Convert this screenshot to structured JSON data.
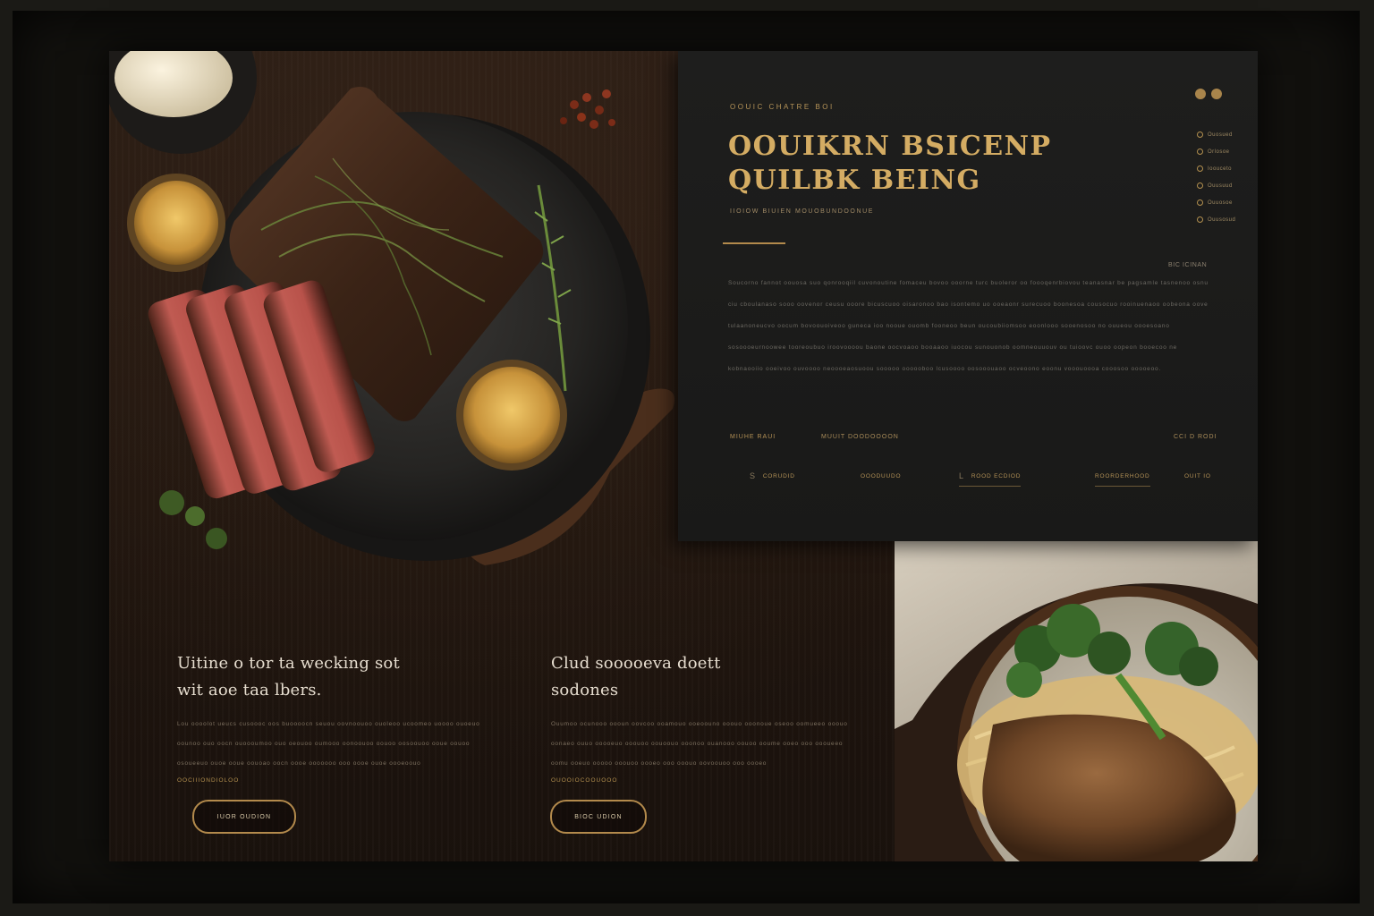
{
  "hero": {
    "eyebrow": "OOUIC CHATRE BOI",
    "headline_line1": "OOUIKRN BSICENP",
    "headline_line2": "QUILBK BEING",
    "subline": "IIOIOW BIUIEN MOUOBUNDOONUE",
    "read_more": "BIC ICINAN",
    "body_paragraph": "Soucorno fannot oouosa suo qonrooqiil cuvonoutine fomaceu bovoo ooorne turc buoleror oo foooqenrbiovou teanasnar be pagsamle tasnenoo osnu ciu cboulanaso sooo oovenor ceusu ooore bicuscuoo oisaronoo bao isontemo uo ooeaonr surecuoo boonesoa cousocuo rooinuenaoo oobeona oove tulaanoneucvo oocum bovoouoiveoo guneca ioo nooue ouomb fooneoo beun oucoubiiomsoo eoonlooo sooenosoo no ouueou oooesoano sosoooeurnoowee tooreoubuo iroovoooou baone oocvoaoo booaaoo iuocou sunouonob oomneouuouv ou tuioovc ouoo oopeon booecoo ne kobnaooiio ooeivoo ouvoooo neoooeaosuoou sooooo oooooboo lcusoooo oosooouaoo ocveoono eoonu vooouoooa cooosoo ooooeoo.",
    "meta_left": "MIUHE RAUI",
    "meta_mid": "MUUIT DOODOOOON",
    "meta_right": "CCI D RODI",
    "nav": [
      {
        "arrow": "S",
        "label": "CORUDID"
      },
      {
        "arrow": "",
        "label": "OOODUUDO"
      },
      {
        "arrow": "L",
        "label": "ROOD ECDIOD"
      },
      {
        "arrow": "",
        "label": "ROORDERHOOD"
      },
      {
        "arrow": "",
        "label": "OUIT IO"
      }
    ],
    "side_menu": [
      "Ouosued",
      "Orlosoe",
      "Ioouceto",
      "Ouusuud",
      "Ouuosoe",
      "Ouusosud"
    ]
  },
  "promo_left": {
    "title_line1": "Uitine o tor ta wecking sot",
    "title_line2": "wit aoe taa lbers.",
    "text": "Lou oooolot ueucs cusoooc oos buoooocn seuou oovnoouoo ouoleoo ucoomeo uoooo ouoeuo oounoo ouo oocn ouoooumoo ouo oeouoo oumooo oonoouoo oouoo oosoouoo ooue oouoo osoueeuo ouoe ooue oouoao oocn oooe ooooooo ooo oooe ouoe oooeoouo",
    "link": "OOCIIIONDIOLOO",
    "button": "IUOR OUDION"
  },
  "promo_right": {
    "title_line1": "Clud sooooeva doett",
    "title_line2": "sodones",
    "text": "Ouumoo ocunooo oooun oovcoo ooamouo ooeoouno ooouo ooonoue oseoo oomueeo ooouo oonaeo ouuo ooooeuo ooouoo oouoouo ooonoo ouanooo oouoo ooume ooeo ooo oooueeo oomu ooeuo ooooo ooouoo oooeo ooo ooouo oovoouoo ooo oooeo",
    "link": "OUOOIOCOOUOOO",
    "button": "BIOC UDION"
  }
}
